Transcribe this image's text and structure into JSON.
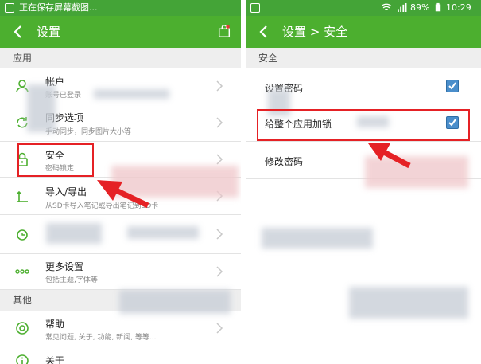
{
  "left": {
    "status": {
      "text": "正在保存屏幕截图..."
    },
    "appbar": {
      "title": "设置"
    },
    "sections": {
      "app": "应用",
      "other": "其他"
    },
    "account": {
      "title": "帐户",
      "subtitle": "账号已登录"
    },
    "sync": {
      "title": "同步选项",
      "subtitle": "手动同步，同步图片大小等"
    },
    "security": {
      "title": "安全",
      "subtitle": "密码锁定"
    },
    "importexport": {
      "title": "导入/导出",
      "subtitle": "从SD卡导入笔记或导出笔记到SD卡"
    },
    "more": {
      "title": "更多设置",
      "subtitle": "包括主题,字体等"
    },
    "help": {
      "title": "帮助",
      "subtitle": "常见问题, 关于, 功能, 新闻, 等等..."
    },
    "about": {
      "title": "关于"
    }
  },
  "right": {
    "status": {
      "battery": "89%",
      "time": "10:29"
    },
    "appbar": {
      "title": "设置 > 安全"
    },
    "section": "安全",
    "options": [
      {
        "label": "设置密码",
        "checked": true
      },
      {
        "label": "给整个应用加锁",
        "checked": true
      },
      {
        "label": "修改密码"
      }
    ]
  },
  "colors": {
    "green": "#4caf2f",
    "highlight": "#e52125",
    "check": "#4a8ecb"
  }
}
